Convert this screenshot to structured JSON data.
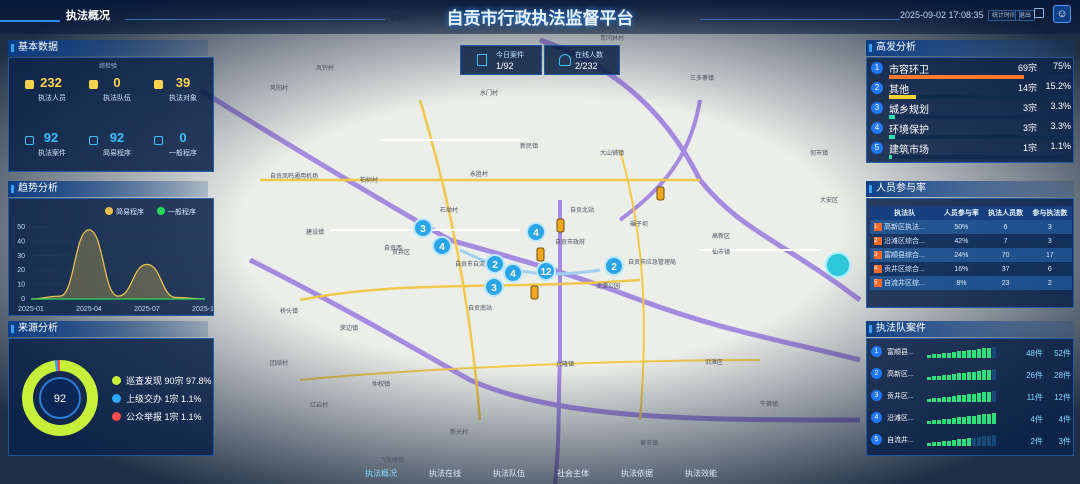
{
  "header": {
    "title": "自贡市行政执法监督平台",
    "nav_left": "执法概况",
    "datetime": "2025-09-02 17:08:35",
    "btn1": "统计时间",
    "btn2": "退出"
  },
  "top_stats": {
    "today_cases_label": "今日案件",
    "today_cases_value": "1/92",
    "online_label": "在线人数",
    "online_value": "2/232"
  },
  "basic": {
    "title": "基本数据",
    "sub": "综检验",
    "items": [
      {
        "value": "232",
        "label": "执法人员",
        "color": "#ffd34d"
      },
      {
        "value": "0",
        "label": "执法队伍",
        "color": "#ffd34d"
      },
      {
        "value": "39",
        "label": "执法对象",
        "color": "#ffd34d"
      },
      {
        "value": "92",
        "label": "执法案件",
        "color": "#39c0ff"
      },
      {
        "value": "92",
        "label": "简易程序",
        "color": "#39c0ff"
      },
      {
        "value": "0",
        "label": "一般程序",
        "color": "#39c0ff"
      }
    ]
  },
  "trend": {
    "title": "趋势分析",
    "legend": [
      "简易程序",
      "一般程序"
    ],
    "legend_colors": [
      "#e8c04a",
      "#2bd95a"
    ]
  },
  "chart_data": {
    "type": "area",
    "x": [
      "2025-01",
      "2025-04",
      "2025-07",
      "2025-10"
    ],
    "ylim": [
      0,
      50
    ],
    "yticks": [
      0,
      10,
      20,
      30,
      40,
      50
    ],
    "series": [
      {
        "name": "简易程序",
        "points": [
          [
            0,
            0
          ],
          [
            0.5,
            2
          ],
          [
            1,
            48
          ],
          [
            1.5,
            2
          ],
          [
            2,
            24
          ],
          [
            2.5,
            1
          ],
          [
            3,
            0
          ]
        ]
      },
      {
        "name": "一般程序",
        "points": [
          [
            0,
            0
          ],
          [
            3,
            0
          ]
        ]
      }
    ]
  },
  "source": {
    "title": "来源分析",
    "center": "92",
    "items": [
      {
        "label": "巡查发现",
        "text": "巡查发现 90宗 97.8%",
        "color": "#c7f03a"
      },
      {
        "label": "上级交办",
        "text": "上级交办 1宗 1.1%",
        "color": "#2ea7ff"
      },
      {
        "label": "公众举报",
        "text": "公众举报 1宗 1.1%",
        "color": "#ff4d4d"
      }
    ],
    "values": [
      97.8,
      1.1,
      1.1
    ]
  },
  "hot": {
    "title": "高发分析",
    "items": [
      {
        "num": "1",
        "label": "市容环卫",
        "cnt": "69宗",
        "pct": "75%",
        "ratio": 0.75,
        "color": "#ff7a2a"
      },
      {
        "num": "2",
        "label": "其他",
        "cnt": "14宗",
        "pct": "15.2%",
        "ratio": 0.152,
        "color": "#ffd12a"
      },
      {
        "num": "3",
        "label": "城乡规划",
        "cnt": "3宗",
        "pct": "3.3%",
        "ratio": 0.033,
        "color": "#2de0b0"
      },
      {
        "num": "4",
        "label": "环境保护",
        "cnt": "3宗",
        "pct": "3.3%",
        "ratio": 0.033,
        "color": "#2de0b0"
      },
      {
        "num": "5",
        "label": "建筑市场",
        "cnt": "1宗",
        "pct": "1.1%",
        "ratio": 0.011,
        "color": "#2de0b0"
      }
    ]
  },
  "participation": {
    "title": "人员参与率",
    "headers": [
      "执法队",
      "人员参与率",
      "执法人员数",
      "参与执法数"
    ],
    "rows": [
      {
        "n": "1",
        "name": "高新区执法...",
        "rate": "50%",
        "people": "6",
        "join": "3",
        "color": "#ff6a2a"
      },
      {
        "n": "2",
        "name": "沿滩区综合...",
        "rate": "42%",
        "people": "7",
        "join": "3",
        "color": "#ff6a2a"
      },
      {
        "n": "3",
        "name": "富顺县综合...",
        "rate": "24%",
        "people": "70",
        "join": "17",
        "color": "#ff6a2a"
      },
      {
        "n": "4",
        "name": "贡井区综合...",
        "rate": "16%",
        "people": "37",
        "join": "6",
        "color": "#ff6a2a"
      },
      {
        "n": "5",
        "name": "自流井区综...",
        "rate": "8%",
        "people": "23",
        "join": "2",
        "color": "#ff6a2a"
      }
    ]
  },
  "teams": {
    "title": "执法队案件",
    "items": [
      {
        "num": "1",
        "label": "富顺县...",
        "cnt": "48",
        "tot": "52",
        "ratio": 0.92
      },
      {
        "num": "2",
        "label": "高新区...",
        "cnt": "26",
        "tot": "28",
        "ratio": 0.93
      },
      {
        "num": "3",
        "label": "贡井区...",
        "cnt": "11",
        "tot": "12",
        "ratio": 0.9
      },
      {
        "num": "4",
        "label": "沿滩区...",
        "cnt": "4",
        "tot": "4",
        "ratio": 1
      },
      {
        "num": "5",
        "label": "自流井...",
        "cnt": "2",
        "tot": "3",
        "ratio": 0.66
      }
    ]
  },
  "bottom_nav": [
    "执法概况",
    "执法在线",
    "执法队伍",
    "社会主体",
    "执法依据",
    "执法效能"
  ],
  "map": {
    "labels": [
      "张福村",
      "风铃村",
      "风阳村",
      "青冈林村",
      "三多寨镇",
      "何市镇",
      "水门村",
      "新民镇",
      "永胜村",
      "大山铺镇",
      "自贡凤鸣通用机场",
      "柏树村",
      "石坳村",
      "建设镇",
      "自贡西",
      "自贡北站",
      "自贡市政府",
      "自贡市自流井",
      "龙潭公园",
      "自贡南站",
      "自贡市应急管理局",
      "碾子坝",
      "高新区",
      "仙市镇",
      "桥头镇",
      "荣边镇",
      "团结村",
      "贡井区",
      "沿滩区",
      "兴隆镇",
      "新光村",
      "飞龙峡镇",
      "黄市镇",
      "仲权镇",
      "红岩村",
      "牛佛镇",
      "大安区"
    ],
    "clusters": [
      "3",
      "4",
      "4",
      "2",
      "4",
      "3",
      "12",
      "2"
    ]
  }
}
